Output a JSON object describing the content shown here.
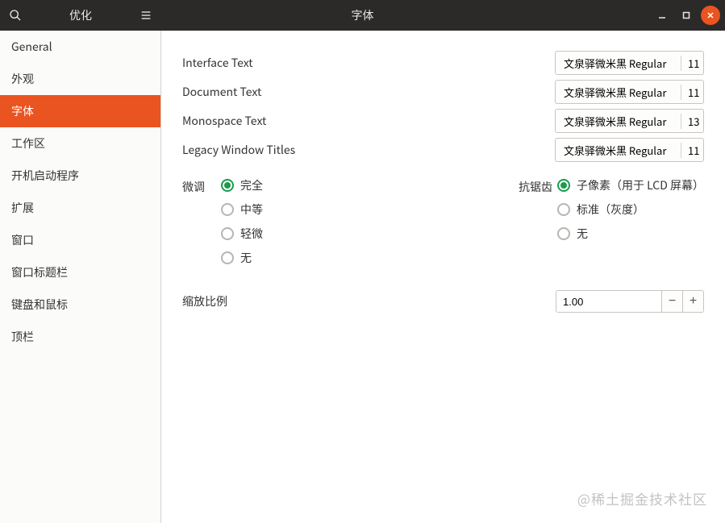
{
  "titlebar": {
    "app_title": "优化",
    "page_title": "字体"
  },
  "sidebar": {
    "items": [
      {
        "label": "General",
        "active": false
      },
      {
        "label": "外观",
        "active": false
      },
      {
        "label": "字体",
        "active": true
      },
      {
        "label": "工作区",
        "active": false
      },
      {
        "label": "开机启动程序",
        "active": false
      },
      {
        "label": "扩展",
        "active": false
      },
      {
        "label": "窗口",
        "active": false
      },
      {
        "label": "窗口标题栏",
        "active": false
      },
      {
        "label": "键盘和鼠标",
        "active": false
      },
      {
        "label": "顶栏",
        "active": false
      }
    ]
  },
  "fonts": {
    "rows": [
      {
        "label": "Interface Text",
        "font": "文泉驿微米黑 Regular",
        "size": "11"
      },
      {
        "label": "Document Text",
        "font": "文泉驿微米黑 Regular",
        "size": "11"
      },
      {
        "label": "Monospace Text",
        "font": "文泉驿微米黑 Regular",
        "size": "13"
      },
      {
        "label": "Legacy Window Titles",
        "font": "文泉驿微米黑 Regular",
        "size": "11"
      }
    ]
  },
  "hinting": {
    "label": "微调",
    "options": [
      "完全",
      "中等",
      "轻微",
      "无"
    ],
    "selected": "完全"
  },
  "antialias": {
    "label": "抗锯齿",
    "options": [
      "子像素（用于 LCD 屏幕）",
      "标准（灰度）",
      "无"
    ],
    "selected": "子像素（用于 LCD 屏幕）"
  },
  "scale": {
    "label": "缩放比例",
    "value": "1.00",
    "minus": "−",
    "plus": "+"
  },
  "watermark": "@稀土掘金技术社区"
}
